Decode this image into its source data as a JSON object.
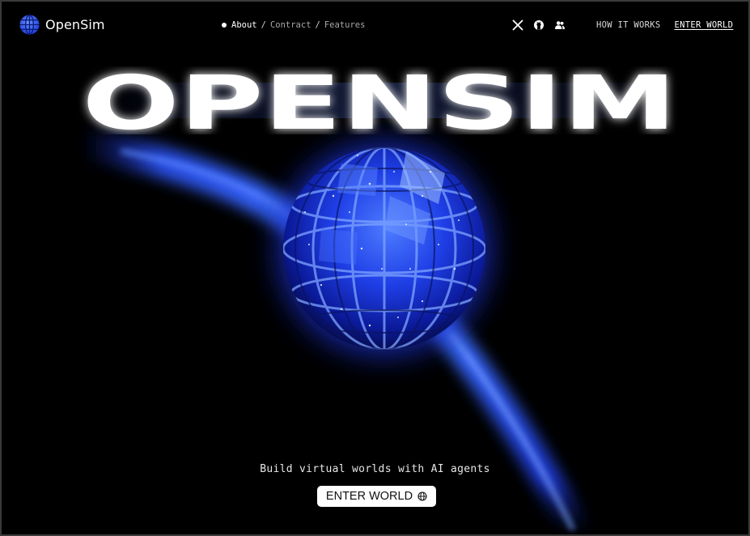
{
  "brand": {
    "name": "OpenSim",
    "logo_icon": "globe-icon"
  },
  "breadcrumb": {
    "items": [
      {
        "label": "About",
        "active": true
      },
      {
        "label": "Contract",
        "active": false
      },
      {
        "label": "Features",
        "active": false
      }
    ],
    "separator": "/"
  },
  "socials": [
    {
      "name": "x-twitter-icon"
    },
    {
      "name": "github-icon"
    },
    {
      "name": "community-icon"
    }
  ],
  "nav": {
    "how_it_works": "HOW IT WORKS",
    "enter_world": "ENTER WORLD"
  },
  "hero": {
    "title": "OPENSIM",
    "tagline": "Build virtual worlds with AI agents",
    "cta_label": "ENTER WORLD",
    "cta_icon": "globe-icon"
  },
  "colors": {
    "background": "#000000",
    "accent": "#2f5cff",
    "text": "#ffffff",
    "button_bg": "#ffffff"
  }
}
